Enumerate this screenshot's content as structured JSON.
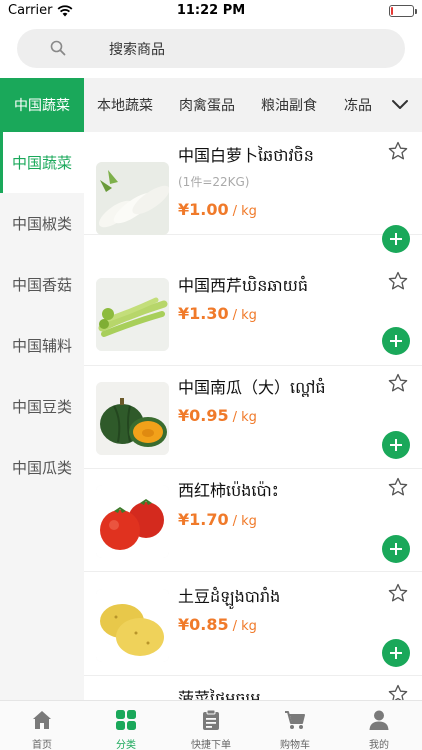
{
  "status": {
    "carrier": "Carrier",
    "time": "11:22 PM",
    "battery_level": 0.1
  },
  "search": {
    "placeholder": "搜索商品",
    "icon": "search-icon"
  },
  "top_tabs": [
    {
      "label": "中国蔬菜",
      "active": true
    },
    {
      "label": "本地蔬菜",
      "active": false
    },
    {
      "label": "肉禽蛋品",
      "active": false
    },
    {
      "label": "粮油副食",
      "active": false
    },
    {
      "label": "冻品",
      "active": false
    }
  ],
  "sidebar": {
    "items": [
      {
        "label": "中国蔬菜",
        "active": true
      },
      {
        "label": "中国椒类",
        "active": false
      },
      {
        "label": "中国香菇",
        "active": false
      },
      {
        "label": "中国辅料",
        "active": false
      },
      {
        "label": "中国豆类",
        "active": false
      },
      {
        "label": "中国瓜类",
        "active": false
      }
    ]
  },
  "products": [
    {
      "name": "中国白萝卜ឆៃថាវចិន",
      "spec": "(1件=22KG)",
      "price": "¥1.00",
      "unit": "/ kg",
      "image": "white-radish"
    },
    {
      "name": "中国西芹ឃិនឆាយធំ",
      "spec": "",
      "price": "¥1.30",
      "unit": "/ kg",
      "image": "celery"
    },
    {
      "name": "中国南瓜（大）ល្ពៅធំ",
      "spec": "",
      "price": "¥0.95",
      "unit": "/ kg",
      "image": "pumpkin"
    },
    {
      "name": "西红柿ប៉េងប៉ោះ",
      "spec": "",
      "price": "¥1.70",
      "unit": "/ kg",
      "image": "tomato"
    },
    {
      "name": "土豆ដំឡូងបារាំង",
      "spec": "",
      "price": "¥0.85",
      "unit": "/ kg",
      "image": "potato"
    },
    {
      "name": "菠菜ផ្ទៃមធ្យម",
      "spec": "",
      "price": "",
      "unit": "",
      "image": "greens"
    }
  ],
  "bottom_nav": [
    {
      "label": "首页",
      "icon": "home-icon",
      "active": false
    },
    {
      "label": "分类",
      "icon": "category-icon",
      "active": true
    },
    {
      "label": "快捷下单",
      "icon": "clipboard-icon",
      "active": false
    },
    {
      "label": "购物车",
      "icon": "cart-icon",
      "active": false
    },
    {
      "label": "我的",
      "icon": "user-icon",
      "active": false
    }
  ],
  "colors": {
    "accent": "#1aa85a",
    "price": "#f07a2a",
    "battery_low": "#e53935"
  }
}
